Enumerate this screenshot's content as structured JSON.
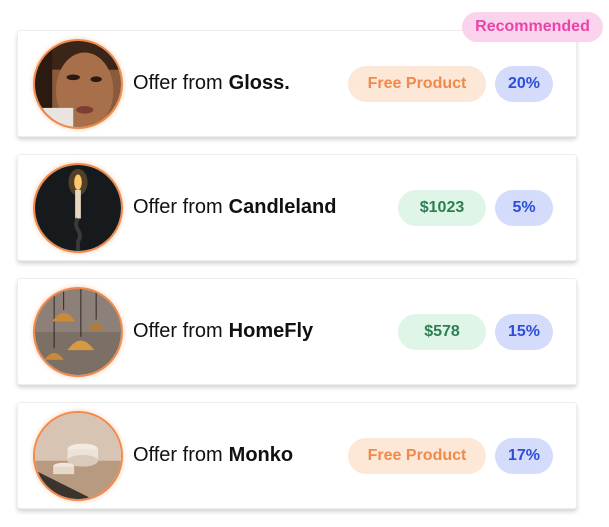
{
  "badge": {
    "label": "Recommended"
  },
  "offer_prefix": "Offer from",
  "offers": [
    {
      "brand": "Gloss.",
      "reward": "Free Product",
      "percent": "20%",
      "reward_color": "#f08a4b",
      "photo_icon": "portrait-photo"
    },
    {
      "brand": "Candleland",
      "reward": "$1023",
      "percent": "5%",
      "reward_color": "#2f7d54",
      "photo_icon": "candle-photo"
    },
    {
      "brand": "HomeFly",
      "reward": "$578",
      "percent": "15%",
      "reward_color": "#2f7d54",
      "photo_icon": "pendant-lamps-photo"
    },
    {
      "brand": "Monko",
      "reward": "Free Product",
      "percent": "17%",
      "reward_color": "#f08a4b",
      "photo_icon": "cosmetics-jars-photo"
    }
  ]
}
